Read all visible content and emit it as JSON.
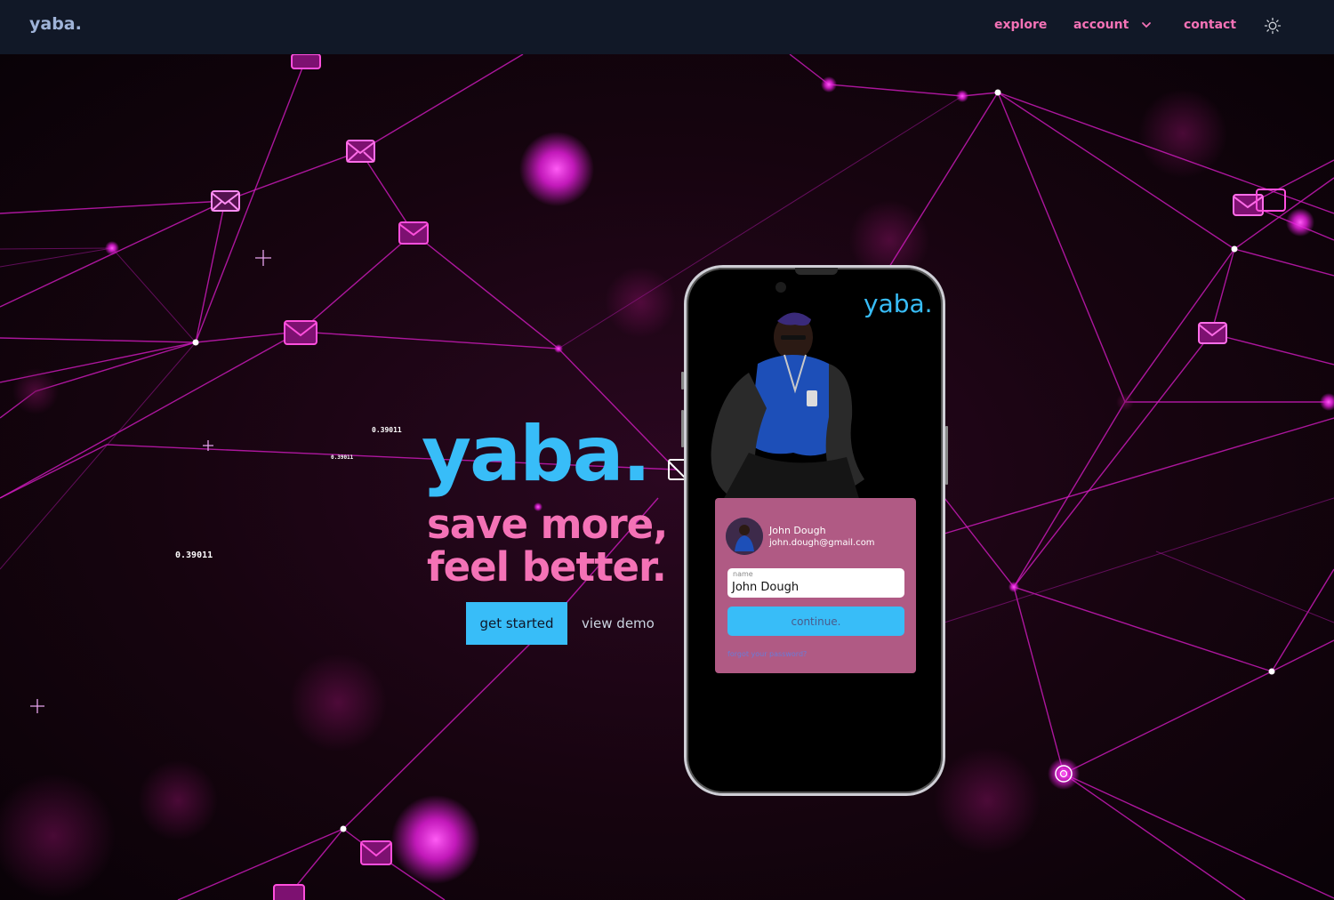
{
  "nav": {
    "logo": "yaba.",
    "links": [
      {
        "label": "explore"
      },
      {
        "label": "account"
      },
      {
        "label": "contact"
      }
    ],
    "theme_icon": "sun-icon",
    "account_icon": "chevron-down-icon"
  },
  "hero": {
    "brand": "yaba.",
    "tagline_line1": "save more,",
    "tagline_line2": "feel better.",
    "cta_primary": "get started",
    "cta_secondary": "view demo",
    "floating_numbers": [
      "0.39011",
      "0.39011",
      "0.39011"
    ]
  },
  "phone": {
    "logo": "yaba.",
    "card": {
      "user_name": "John Dough",
      "user_email": "john.dough@gmail.com",
      "field_label": "name",
      "field_value": "John Dough",
      "continue_label": "continue.",
      "forgot_label": "forgot your password?"
    }
  },
  "colors": {
    "nav_bg": "#111827",
    "accent_blue": "#38bdf8",
    "accent_pink": "#f472b6",
    "network_magenta": "#e11dd8",
    "card_bg": "#b05a84"
  }
}
